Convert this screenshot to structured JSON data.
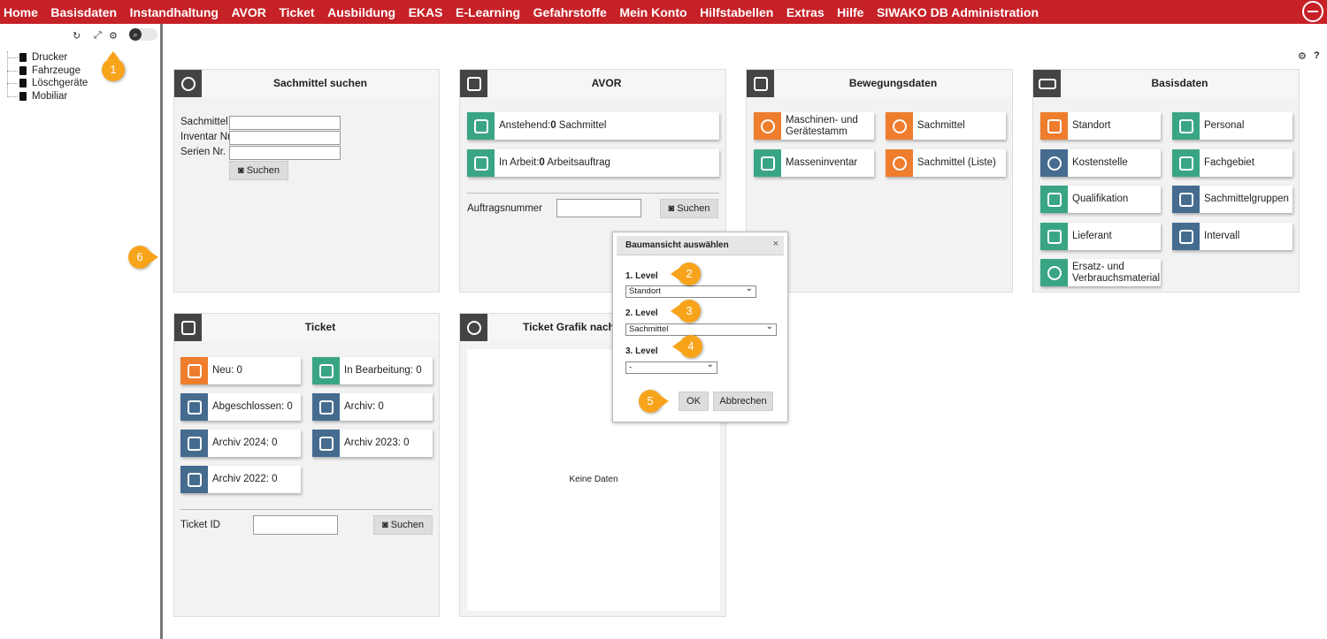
{
  "menu": [
    "Home",
    "Basisdaten",
    "Instandhaltung",
    "AVOR",
    "Ticket",
    "Ausbildung",
    "EKAS",
    "E-Learning",
    "Gefahrstoffe",
    "Mein Konto",
    "Hilfstabellen",
    "Extras",
    "Hilfe",
    "SIWAKO DB Administration"
  ],
  "tree": [
    "Drucker",
    "Fahrzeuge",
    "Löschgeräte",
    "Mobiliar"
  ],
  "badges": {
    "b1": "1",
    "b2": "2",
    "b3": "3",
    "b4": "4",
    "b5": "5",
    "b6": "6"
  },
  "sachmittel": {
    "title": "Sachmittel suchen",
    "label_sachmittel": "Sachmittel",
    "label_inventar": "Inventar Nr.",
    "label_serien": "Serien Nr.",
    "search": "Suchen"
  },
  "avor": {
    "title": "AVOR",
    "anstehend_prefix": "Anstehend:",
    "anstehend_count": "0",
    "anstehend_suffix": " Sachmittel",
    "arbeit_prefix": "In Arbeit:",
    "arbeit_count": "0",
    "arbeit_suffix": " Arbeitsauftrag",
    "auftrag_label": "Auftragsnummer",
    "search": "Suchen"
  },
  "bewegung": {
    "title": "Bewegungsdaten",
    "tiles": [
      "Maschinen- und Gerätestamm",
      "Sachmittel",
      "Masseninventar",
      "Sachmittel (Liste)"
    ]
  },
  "basis": {
    "title": "Basisdaten",
    "tiles": [
      "Standort",
      "Personal",
      "Kostenstelle",
      "Fachgebiet",
      "Qualifikation",
      "Sachmittelgruppen",
      "Lieferant",
      "Intervall",
      "Ersatz- und Verbrauchsmaterial"
    ]
  },
  "ticket": {
    "title": "Ticket",
    "tiles": [
      "Neu: 0",
      "In Bearbeitung: 0",
      "Abgeschlossen: 0",
      "Archiv: 0",
      "Archiv 2024: 0",
      "Archiv 2023: 0",
      "Archiv 2022: 0"
    ],
    "id_label": "Ticket ID",
    "search": "Suchen"
  },
  "grafik": {
    "title": "Ticket Grafik nach T",
    "empty": "Keine Daten"
  },
  "dialog": {
    "title": "Baumansicht auswählen",
    "close": "×",
    "level1_label": "1. Level",
    "level1_value": "Standort",
    "level2_label": "2. Level",
    "level2_value": "Sachmittel",
    "level3_label": "3. Level",
    "level3_value": "-",
    "ok": "OK",
    "cancel": "Abbrechen"
  },
  "help": "?",
  "colors": {
    "topbar": "#c62127",
    "green": "#3aa584",
    "orange": "#ee7d2d",
    "blue": "#456b8f",
    "badge": "#f7a41b"
  }
}
